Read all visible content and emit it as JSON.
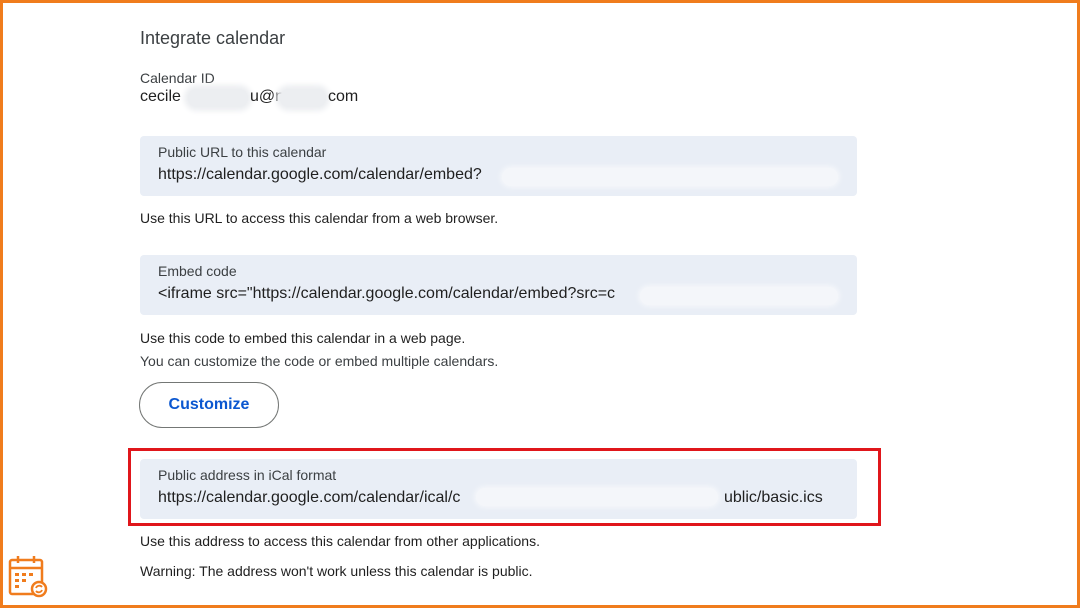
{
  "section_title": "Integrate calendar",
  "calendar_id": {
    "label": "Calendar ID",
    "prefix": "cecile",
    "middle": "u@n",
    "suffix": "com"
  },
  "public_url": {
    "label": "Public URL to this calendar",
    "value": "https://calendar.google.com/calendar/embed?",
    "help": "Use this URL to access this calendar from a web browser."
  },
  "embed": {
    "label": "Embed code",
    "value": "<iframe src=\"https://calendar.google.com/calendar/embed?src=c",
    "help": "Use this code to embed this calendar in a web page.",
    "help_secondary": "You can customize the code or embed multiple calendars.",
    "customize_label": "Customize"
  },
  "ical": {
    "label": "Public address in iCal format",
    "value_start": "https://calendar.google.com/calendar/ical/c",
    "value_end": "ublic/basic.ics",
    "help": "Use this address to access this calendar from other applications.",
    "warning": "Warning: The address won't work unless this calendar is public."
  },
  "colors": {
    "frame": "#f07c1d",
    "highlight": "#e0161b",
    "field_bg": "#e9eef6",
    "button_text": "#0b57d0"
  },
  "icons": {
    "logo": "calendar-sync-icon"
  }
}
